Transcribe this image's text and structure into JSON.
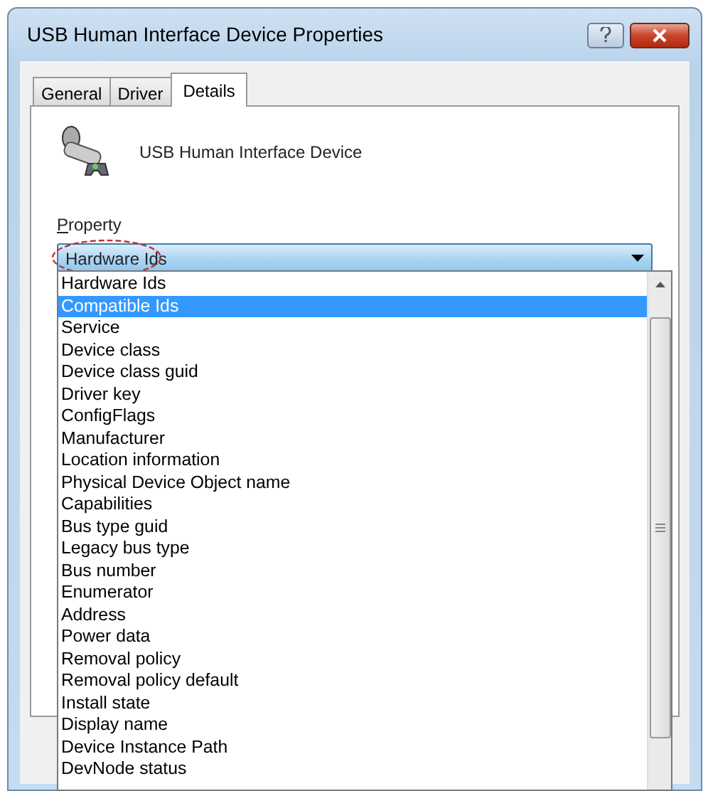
{
  "window": {
    "title": "USB Human Interface Device Properties"
  },
  "tabs": [
    {
      "label": "General",
      "selected": false
    },
    {
      "label": "Driver",
      "selected": false
    },
    {
      "label": "Details",
      "selected": true
    }
  ],
  "device": {
    "name": "USB Human Interface Device"
  },
  "property": {
    "label": "Property",
    "value": "Hardware Ids"
  },
  "dropdown": {
    "items": [
      {
        "label": "Hardware Ids",
        "selected": false
      },
      {
        "label": "Compatible Ids",
        "selected": true
      },
      {
        "label": "Service",
        "selected": false
      },
      {
        "label": "Device class",
        "selected": false
      },
      {
        "label": "Device class guid",
        "selected": false
      },
      {
        "label": "Driver key",
        "selected": false
      },
      {
        "label": "ConfigFlags",
        "selected": false
      },
      {
        "label": "Manufacturer",
        "selected": false
      },
      {
        "label": "Location information",
        "selected": false
      },
      {
        "label": "Physical Device Object name",
        "selected": false
      },
      {
        "label": "Capabilities",
        "selected": false
      },
      {
        "label": "Bus type guid",
        "selected": false
      },
      {
        "label": "Legacy bus type",
        "selected": false
      },
      {
        "label": "Bus number",
        "selected": false
      },
      {
        "label": "Enumerator",
        "selected": false
      },
      {
        "label": "Address",
        "selected": false
      },
      {
        "label": "Power data",
        "selected": false
      },
      {
        "label": "Removal policy",
        "selected": false
      },
      {
        "label": "Removal policy default",
        "selected": false
      },
      {
        "label": "Install state",
        "selected": false
      },
      {
        "label": "Display name",
        "selected": false
      },
      {
        "label": "Device Instance Path",
        "selected": false
      },
      {
        "label": "DevNode status",
        "selected": false
      }
    ]
  }
}
